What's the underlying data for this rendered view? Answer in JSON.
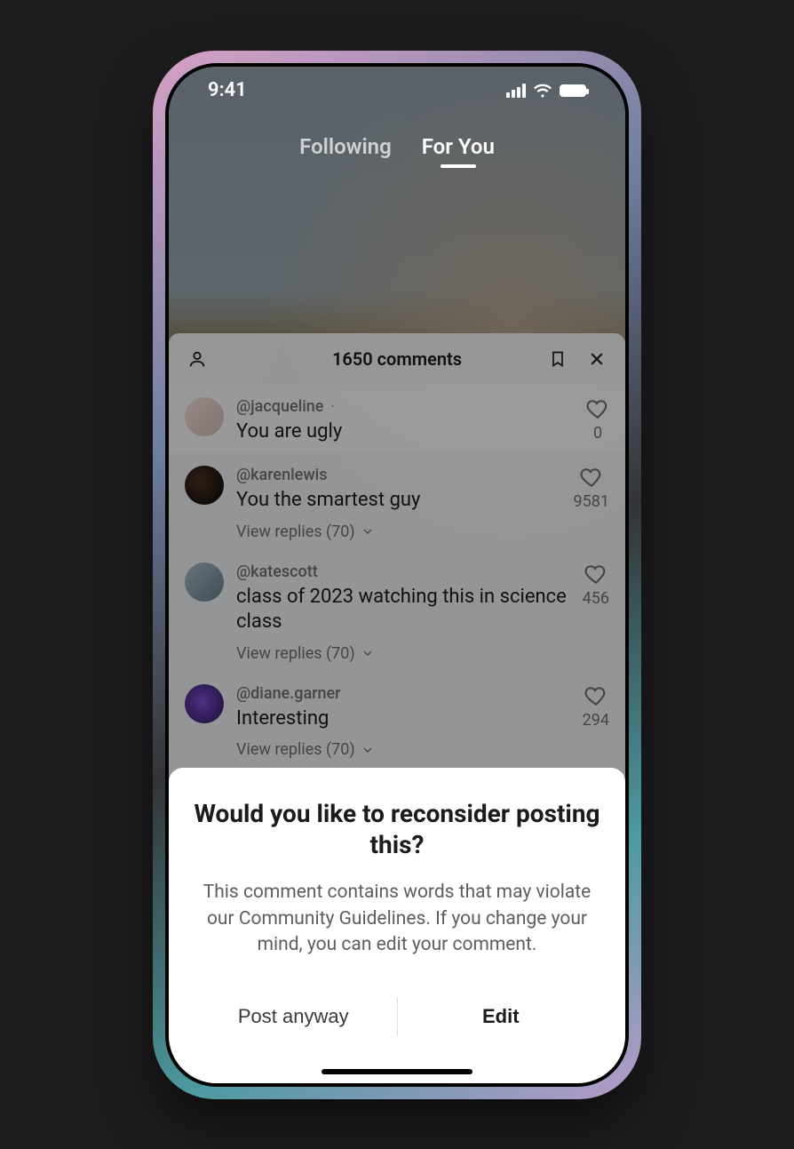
{
  "status_bar": {
    "time": "9:41"
  },
  "feed_tabs": {
    "following": "Following",
    "for_you": "For You"
  },
  "comment_sheet": {
    "title": "1650 comments",
    "comments": [
      {
        "username": "@jacqueline",
        "text": "You are ugly",
        "likes": "0",
        "show_dot": true,
        "avatar_color": "linear-gradient(135deg,#e8d5cf 0%,#c7b0aa 100%)",
        "replies": null
      },
      {
        "username": "@karenlewis",
        "text": "You the smartest guy",
        "likes": "9581",
        "avatar_color": "radial-gradient(circle at 40% 40%, #4a2f20 0%, #1b120d 70%)",
        "replies": "View replies (70)"
      },
      {
        "username": "@katescott",
        "text": "class of 2023 watching this in science class",
        "likes": "456",
        "avatar_color": "linear-gradient(135deg,#a0b2bd 0%, #647784 100%)",
        "replies": "View replies (70)"
      },
      {
        "username": "@diane.garner",
        "text": "Interesting",
        "likes": "294",
        "avatar_color": "radial-gradient(circle at 45% 45%, #7a49c9 0%, #38206a 80%)",
        "replies": "View replies (70)"
      }
    ]
  },
  "modal": {
    "title": "Would you like to reconsider posting this?",
    "body": "This comment contains words that may violate our Community Guidelines. If you change your mind, you can edit your comment.",
    "post_label": "Post anyway",
    "edit_label": "Edit"
  }
}
